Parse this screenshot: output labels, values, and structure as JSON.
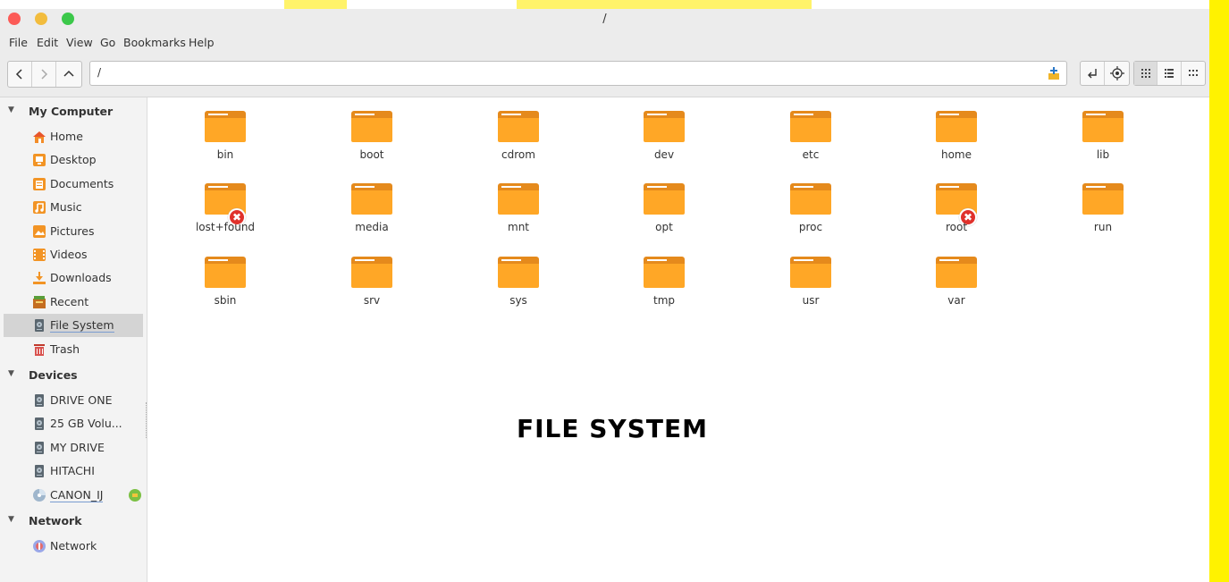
{
  "window": {
    "title": "/"
  },
  "menu": [
    "File",
    "Edit",
    "View",
    "Go",
    "Bookmarks",
    "Help"
  ],
  "path": {
    "value": "/"
  },
  "sidebar": {
    "sections": [
      {
        "label": "My Computer",
        "items": [
          {
            "label": "Home",
            "icon": "home-icon"
          },
          {
            "label": "Desktop",
            "icon": "desktop-icon"
          },
          {
            "label": "Documents",
            "icon": "documents-icon"
          },
          {
            "label": "Music",
            "icon": "music-icon"
          },
          {
            "label": "Pictures",
            "icon": "pictures-icon"
          },
          {
            "label": "Videos",
            "icon": "videos-icon"
          },
          {
            "label": "Downloads",
            "icon": "downloads-icon"
          },
          {
            "label": "Recent",
            "icon": "recent-icon"
          },
          {
            "label": "File System",
            "icon": "drive-icon",
            "selected": true
          },
          {
            "label": "Trash",
            "icon": "trash-icon"
          }
        ]
      },
      {
        "label": "Devices",
        "items": [
          {
            "label": "DRIVE ONE",
            "icon": "drive-icon"
          },
          {
            "label": "25 GB Volu...",
            "icon": "drive-icon"
          },
          {
            "label": "MY DRIVE",
            "icon": "drive-icon"
          },
          {
            "label": "HITACHI",
            "icon": "drive-icon"
          },
          {
            "label": "CANON_IJ",
            "icon": "cd-icon"
          }
        ]
      },
      {
        "label": "Network",
        "items": [
          {
            "label": "Network",
            "icon": "network-icon"
          }
        ]
      }
    ]
  },
  "files": [
    {
      "name": "bin"
    },
    {
      "name": "boot"
    },
    {
      "name": "cdrom"
    },
    {
      "name": "dev"
    },
    {
      "name": "etc"
    },
    {
      "name": "home"
    },
    {
      "name": "lib"
    },
    {
      "name": "lost+found",
      "locked": true
    },
    {
      "name": "media"
    },
    {
      "name": "mnt"
    },
    {
      "name": "opt"
    },
    {
      "name": "proc"
    },
    {
      "name": "root",
      "locked": true
    },
    {
      "name": "run"
    },
    {
      "name": "sbin"
    },
    {
      "name": "srv"
    },
    {
      "name": "sys"
    },
    {
      "name": "tmp"
    },
    {
      "name": "usr"
    },
    {
      "name": "var"
    }
  ],
  "caption": "FILE SYSTEM",
  "colors": {
    "accent_folder": "#ffa726",
    "folder_tab": "#e58a1c",
    "highlight": "#fff200"
  }
}
